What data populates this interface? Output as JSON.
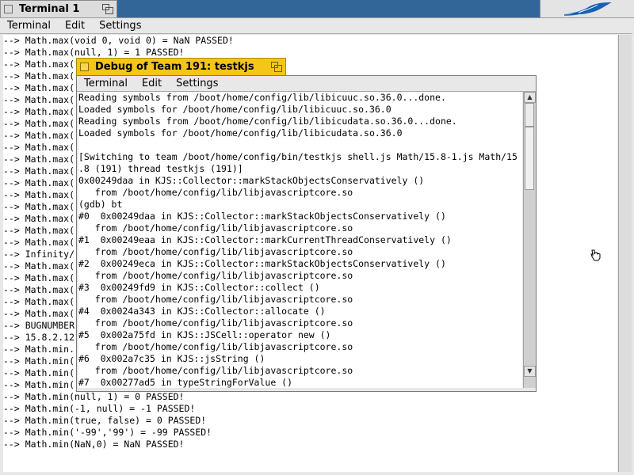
{
  "main_window": {
    "title": "Terminal 1",
    "menu": [
      "Terminal",
      "Edit",
      "Settings"
    ],
    "lines": [
      "--> Math.max(void 0, void 0) = NaN PASSED!",
      "--> Math.max(null, 1) = 1 PASSED!",
      "--> Math.max(",
      "--> Math.max(",
      "--> Math.max(",
      "--> Math.max(",
      "--> Math.max(",
      "--> Math.max(",
      "--> Math.max(",
      "--> Math.max(",
      "--> Math.max(",
      "--> Math.max(",
      "--> Math.max(",
      "--> Math.max(",
      "--> Math.max(",
      "--> Math.max(",
      "--> Math.max(",
      "--> Math.max(",
      "--> Infinity/",
      "--> Math.max(",
      "--> Math.max(",
      "--> Math.max(",
      "--> Math.max(",
      "--> Math.max(",
      "--> BUGNUMBER",
      "--> 15.8.2.12",
      "--> Math.min.",
      "--> Math.min(",
      "--> Math.min(",
      "--> Math.min(",
      "--> Math.min(null, 1) = 0 PASSED!",
      "--> Math.min(-1, null) = -1 PASSED!",
      "--> Math.min(true, false) = 0 PASSED!",
      "--> Math.min('-99','99') = -99 PASSED!",
      "--> Math.min(NaN,0) = NaN PASSED!"
    ]
  },
  "debug_window": {
    "title": "Debug of Team 191: testkjs",
    "menu": [
      "Terminal",
      "Edit",
      "Settings"
    ],
    "lines": [
      "Reading symbols from /boot/home/config/lib/libicuuc.so.36.0...done.",
      "Loaded symbols for /boot/home/config/lib/libicuuc.so.36.0",
      "Reading symbols from /boot/home/config/lib/libicudata.so.36.0...done.",
      "Loaded symbols for /boot/home/config/lib/libicudata.so.36.0",
      "",
      "[Switching to team /boot/home/config/bin/testkjs shell.js Math/15.8-1.js Math/15",
      ".8 (191) thread testkjs (191)]",
      "0x00249daa in KJS::Collector::markStackObjectsConservatively ()",
      "   from /boot/home/config/lib/libjavascriptcore.so",
      "(gdb) bt",
      "#0  0x00249daa in KJS::Collector::markStackObjectsConservatively ()",
      "   from /boot/home/config/lib/libjavascriptcore.so",
      "#1  0x00249eaa in KJS::Collector::markCurrentThreadConservatively ()",
      "   from /boot/home/config/lib/libjavascriptcore.so",
      "#2  0x00249eca in KJS::Collector::markStackObjectsConservatively ()",
      "   from /boot/home/config/lib/libjavascriptcore.so",
      "#3  0x00249fd9 in KJS::Collector::collect ()",
      "   from /boot/home/config/lib/libjavascriptcore.so",
      "#4  0x0024a343 in KJS::Collector::allocate ()",
      "   from /boot/home/config/lib/libjavascriptcore.so",
      "#5  0x002a75fd in KJS::JSCell::operator new ()",
      "   from /boot/home/config/lib/libjavascriptcore.so",
      "#6  0x002a7c35 in KJS::jsString ()",
      "   from /boot/home/config/lib/libjavascriptcore.so",
      "#7  0x00277ad5 in typeStringForValue ()"
    ]
  },
  "icons": {
    "deskbar_logo": "leaf-feather-icon",
    "cursor": "hand-pointer-icon"
  },
  "colors": {
    "desktop": "#336698",
    "active_tab": "#f5c518",
    "inactive_tab": "#dcdcdc",
    "logo": "#1a5fb4"
  }
}
